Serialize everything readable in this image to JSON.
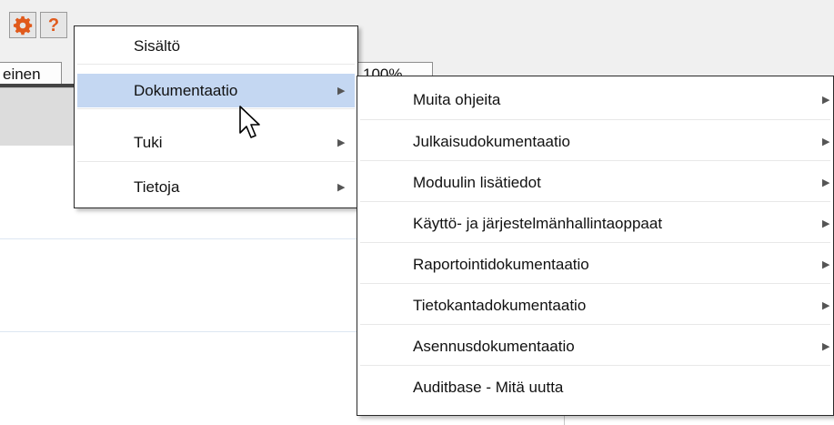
{
  "toolbar": {
    "settings_icon": "gear-icon",
    "help_icon": "help-icon",
    "help_glyph": "?",
    "accent_color": "#e05a1c"
  },
  "tabs": {
    "general": "einen",
    "zoom": "100%"
  },
  "help_menu": {
    "items": [
      {
        "label": "Sisältö",
        "has_submenu": false
      },
      {
        "label": "Dokumentaatio",
        "has_submenu": true,
        "highlighted": true
      },
      {
        "label": "Tuki",
        "has_submenu": true
      },
      {
        "label": "Tietoja",
        "has_submenu": true
      }
    ],
    "submenu_arrow": "▶"
  },
  "documentation_submenu": {
    "items": [
      {
        "label": "Muita ohjeita",
        "has_submenu": true
      },
      {
        "label": "Julkaisudokumentaatio",
        "has_submenu": true
      },
      {
        "label": "Moduulin lisätiedot",
        "has_submenu": true
      },
      {
        "label": "Käyttö- ja järjestelmänhallintaoppaat",
        "has_submenu": true
      },
      {
        "label": "Raportointidokumentaatio",
        "has_submenu": true
      },
      {
        "label": "Tietokantadokumentaatio",
        "has_submenu": true
      },
      {
        "label": "Asennusdokumentaatio",
        "has_submenu": true
      },
      {
        "label": "Auditbase - Mitä uutta",
        "has_submenu": false
      }
    ]
  },
  "colors": {
    "highlight": "#c4d7f2",
    "menu_border": "#2a2a2a",
    "window_bg": "#f0f0f0"
  }
}
